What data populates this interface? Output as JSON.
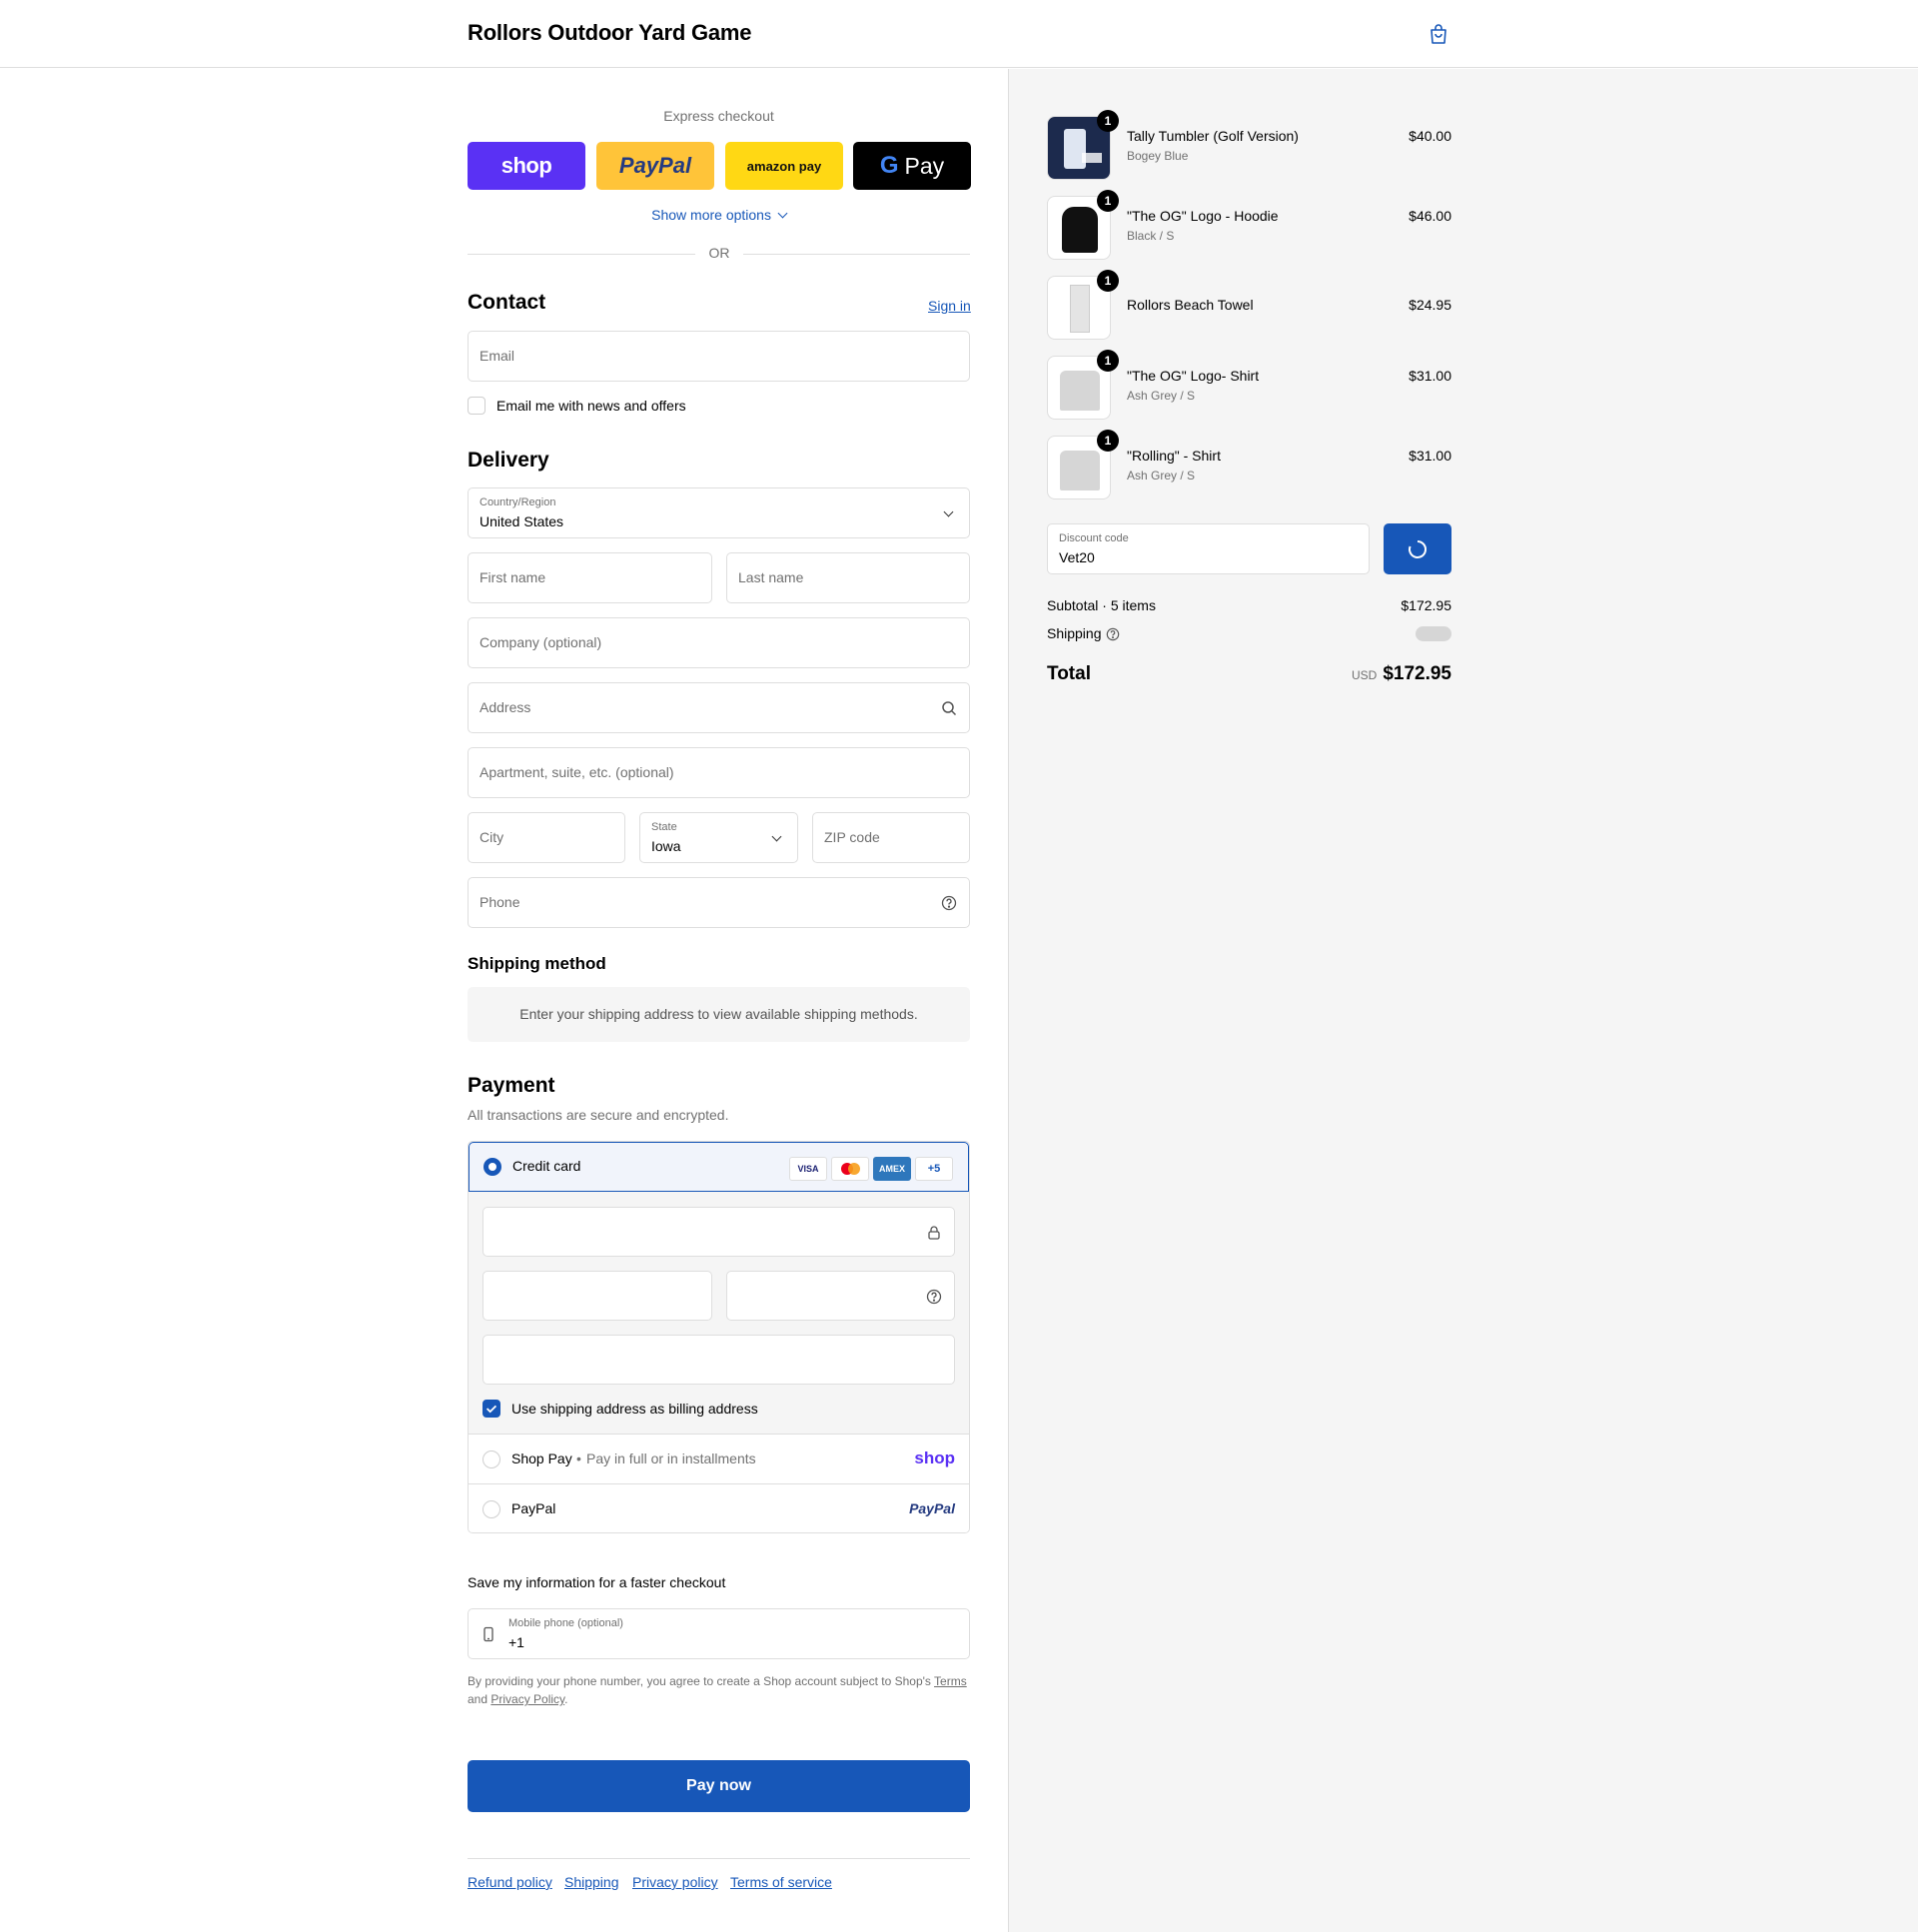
{
  "header": {
    "store_name": "Rollors Outdoor Yard Game",
    "cart_icon": "shopping-bag-icon"
  },
  "express": {
    "label": "Express checkout",
    "buttons": [
      {
        "name": "shop",
        "label": "shop",
        "bg": "#5a31f4",
        "fg": "#ffffff"
      },
      {
        "name": "paypal",
        "label": "PayPal",
        "bg": "#ffc439",
        "fg": "#003087"
      },
      {
        "name": "amazon",
        "label": "amazon pay",
        "bg": "#ffd814",
        "fg": "#000000"
      },
      {
        "name": "gpay",
        "label": "Pay",
        "bg": "#000000",
        "fg": "#ffffff"
      }
    ],
    "show_more": "Show more options",
    "or": "OR"
  },
  "contact": {
    "title": "Contact",
    "sign_in": "Sign in",
    "email_placeholder": "Email",
    "news_label": "Email me with news and offers"
  },
  "delivery": {
    "title": "Delivery",
    "country_label": "Country/Region",
    "country_value": "United States",
    "first_name": "First name",
    "last_name": "Last name",
    "company": "Company (optional)",
    "address": "Address",
    "apartment": "Apartment, suite, etc. (optional)",
    "city": "City",
    "state_label": "State",
    "state_value": "Iowa",
    "zip": "ZIP code",
    "phone": "Phone"
  },
  "shipping_method": {
    "title": "Shipping method",
    "message": "Enter your shipping address to view available shipping methods."
  },
  "payment": {
    "title": "Payment",
    "subtitle": "All transactions are secure and encrypted.",
    "credit_card": "Credit card",
    "card_logos": [
      "VISA",
      "",
      "AMEX",
      "+5"
    ],
    "billing_same": "Use shipping address as billing address",
    "shop_pay": "Shop Pay",
    "shop_pay_sep": "•",
    "shop_pay_desc": "Pay in full or in installments",
    "shop_pay_logo": "shop",
    "paypal": "PayPal",
    "paypal_logo": "PayPal"
  },
  "save_info": {
    "title": "Save my information for a faster checkout",
    "mobile_label": "Mobile phone (optional)",
    "mobile_value": "+1",
    "legal_1": "By providing your phone number, you agree to create a Shop account subject to Shop's ",
    "terms": "Terms",
    "legal_2": "and ",
    "privacy": "Privacy Policy",
    "legal_end": "."
  },
  "pay_now": "Pay now",
  "footer_links": [
    "Refund policy",
    "Shipping",
    "Privacy policy",
    "Terms of service"
  ],
  "summary": {
    "items": [
      {
        "name": "Tally Tumbler (Golf Version)",
        "variant": "Bogey Blue",
        "price": "$40.00",
        "qty": "1"
      },
      {
        "name": "\"The OG\" Logo - Hoodie",
        "variant": "Black / S",
        "price": "$46.00",
        "qty": "1"
      },
      {
        "name": "Rollors Beach Towel",
        "variant": "",
        "price": "$24.95",
        "qty": "1"
      },
      {
        "name": "\"The OG\" Logo- Shirt",
        "variant": "Ash Grey / S",
        "price": "$31.00",
        "qty": "1"
      },
      {
        "name": "\"Rolling\" - Shirt",
        "variant": "Ash Grey / S",
        "price": "$31.00",
        "qty": "1"
      }
    ],
    "discount_label": "Discount code",
    "discount_value": "Vet20",
    "subtotal_label": "Subtotal · 5 items",
    "subtotal_value": "$172.95",
    "shipping_label": "Shipping",
    "total_label": "Total",
    "currency": "USD",
    "total_value": "$172.95"
  },
  "colors": {
    "accent": "#1757b8",
    "border": "#dedede",
    "muted": "#707070",
    "summary_bg": "#f5f5f5"
  }
}
